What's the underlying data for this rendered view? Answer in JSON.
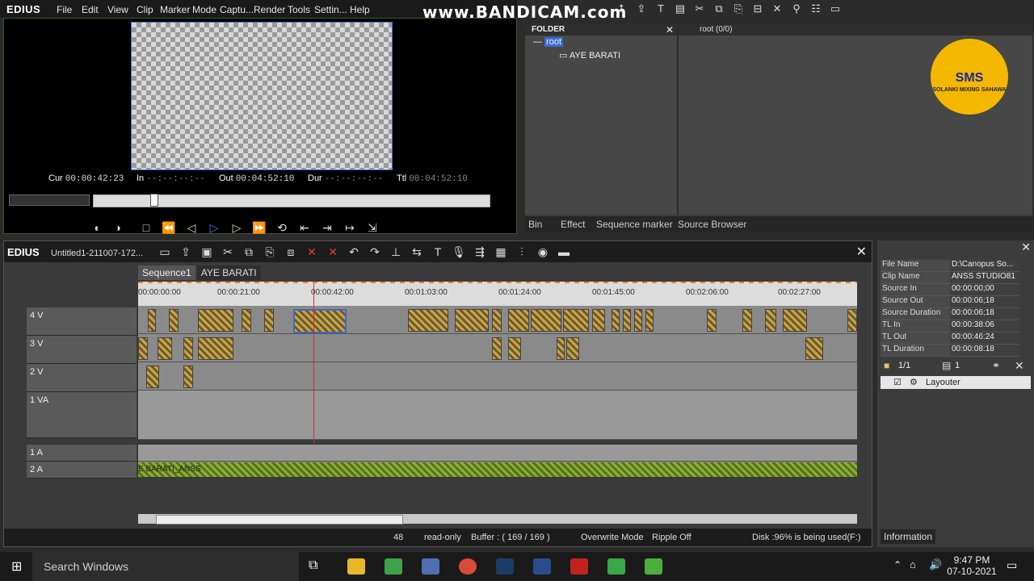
{
  "app": {
    "logo": "EDIUS",
    "menu": [
      "File",
      "Edit",
      "View",
      "Clip",
      "Marker",
      "Mode",
      "Captu...",
      "Render",
      "Tools",
      "Settin...",
      "Help"
    ],
    "watermark": "www.BANDICAM.com"
  },
  "player": {
    "cur_label": "Cur",
    "cur": "00:00:42:23",
    "in_label": "In",
    "in": "--:--:--:--",
    "out_label": "Out",
    "out": "00:04:52:10",
    "dur_label": "Dur",
    "dur": "--:--:--:--",
    "ttl_label": "Ttl",
    "ttl": "00:04:52:10"
  },
  "bin": {
    "folder_header": "FOLDER",
    "root": "root",
    "child": "AYE BARATI",
    "root_header": "root (0/0)",
    "tabs": [
      "Bin",
      "Effect",
      "Sequence marker",
      "Source Browser"
    ]
  },
  "logo_badge": {
    "line1": "SMS",
    "line2": "SOLANKI MIXING SAHAWA"
  },
  "timeline": {
    "logo": "EDIUS",
    "project": "Untitled1-211007-172...",
    "sequence_tabs": [
      "Sequence1",
      "AYE BARATI"
    ],
    "ticks": [
      "00:00:00:00",
      "00:00:21:00",
      "00:00:42:00",
      "00:01:03:00",
      "00:01:24:00",
      "00:01:45:00",
      "00:02:06:00",
      "00:02:27:00"
    ],
    "tracks": [
      "4 V",
      "3 V",
      "2 V",
      "1 VA",
      "1 A",
      "2 A"
    ],
    "audio_clip": "E BARATI_ANSS"
  },
  "status": {
    "count": "48",
    "readonly": "read-only",
    "buffer": "Buffer : ( 169 / 169 )",
    "mode": "Overwrite Mode",
    "ripple": "Ripple Off",
    "disk": "Disk :96% is being used(F:)"
  },
  "info": {
    "rows": [
      {
        "k": "File Name",
        "v": "D:\\Canopus So..."
      },
      {
        "k": "Clip Name",
        "v": "ANSS STUDIO81"
      },
      {
        "k": "Source In",
        "v": "00:00:00;00"
      },
      {
        "k": "Source Out",
        "v": "00:00:06;18"
      },
      {
        "k": "Source Duration",
        "v": "00:00:06;18"
      },
      {
        "k": "TL In",
        "v": "00:00:38:06"
      },
      {
        "k": "TL Out",
        "v": "00:00:46:24"
      },
      {
        "k": "TL Duration",
        "v": "00:00:08:18"
      }
    ],
    "page": "1/1",
    "count": "1",
    "layouter": "Layouter",
    "tab": "Information"
  },
  "taskbar": {
    "search": "Search Windows",
    "time": "9:47 PM",
    "date": "07-10-2021"
  }
}
